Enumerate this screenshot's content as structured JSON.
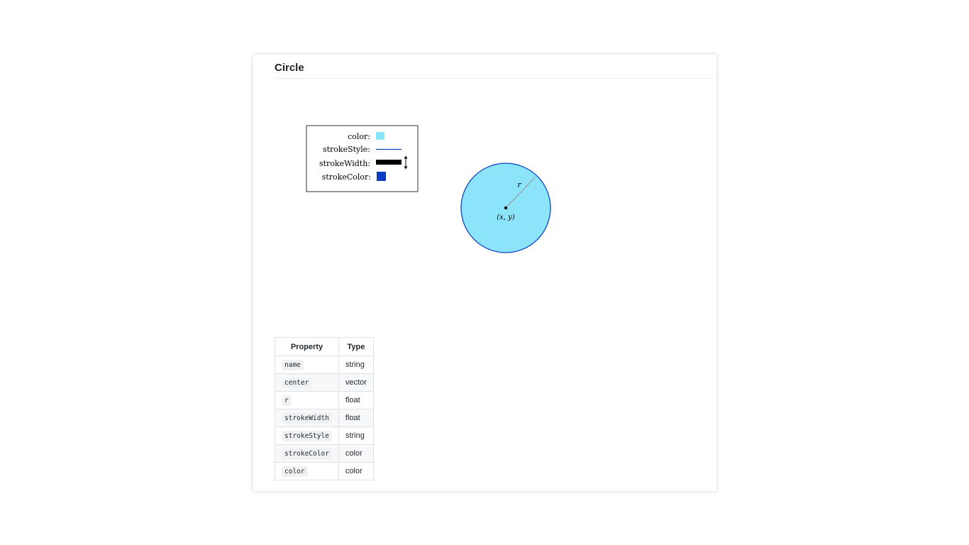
{
  "title": "Circle",
  "legend": {
    "color_label": "color:",
    "stroke_style_label": "strokeStyle:",
    "stroke_width_label": "strokeWidth:",
    "stroke_color_label": "strokeColor:"
  },
  "diagram": {
    "radius_label": "r",
    "center_label": "(x, y)"
  },
  "colors": {
    "fill": "#8ce4fb",
    "stroke": "#0d45c4",
    "stroke_color_swatch": "#0a3fc2",
    "radius_line": "#999999"
  },
  "table": {
    "headers": [
      "Property",
      "Type"
    ],
    "rows": [
      {
        "property": "name",
        "type": "string"
      },
      {
        "property": "center",
        "type": "vector"
      },
      {
        "property": "r",
        "type": "float"
      },
      {
        "property": "strokeWidth",
        "type": "float"
      },
      {
        "property": "strokeStyle",
        "type": "string"
      },
      {
        "property": "strokeColor",
        "type": "color"
      },
      {
        "property": "color",
        "type": "color"
      }
    ]
  }
}
